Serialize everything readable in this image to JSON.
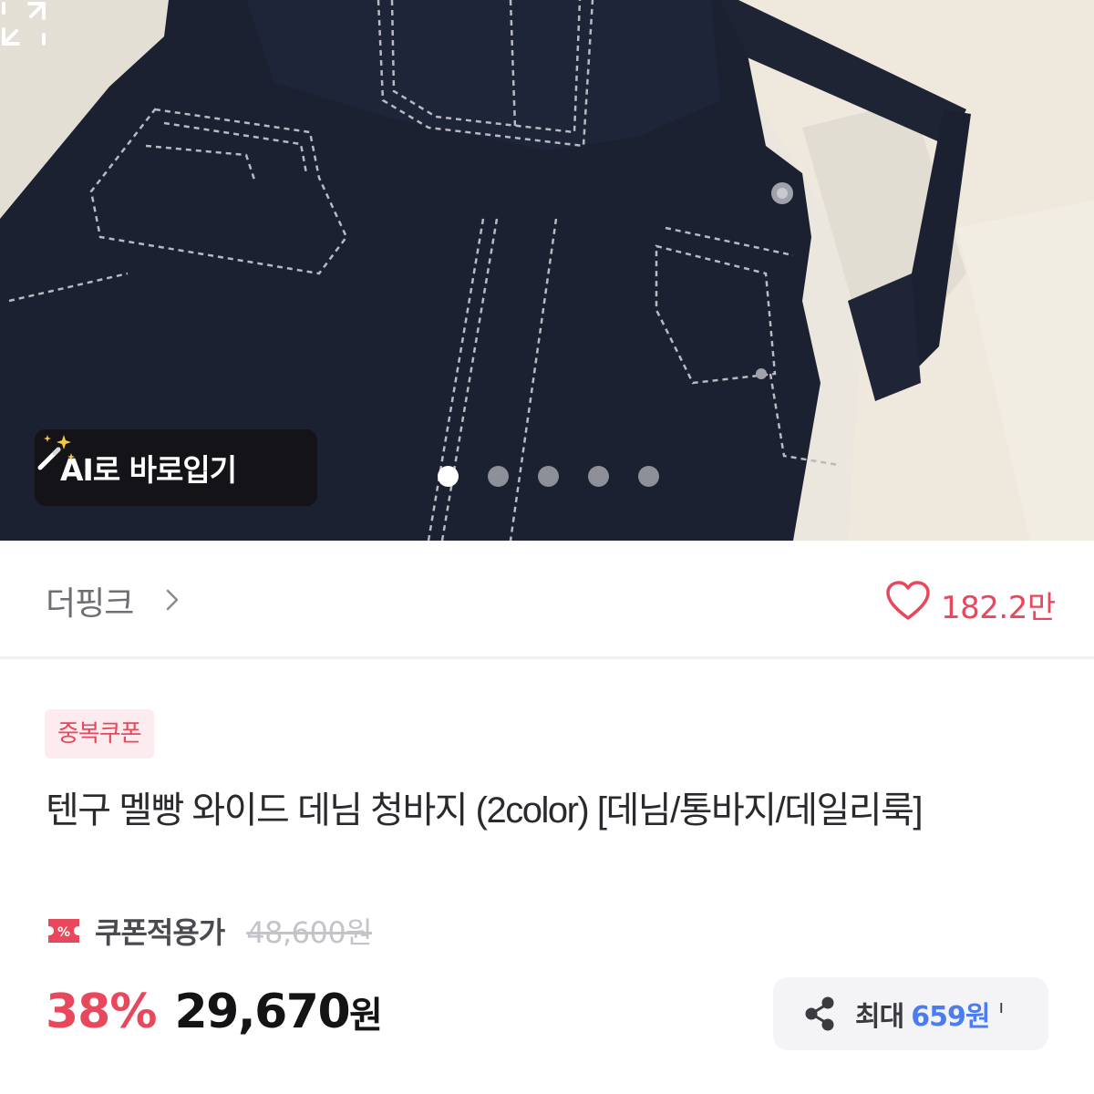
{
  "hero": {
    "ai_button_label": "AI로 바로입기",
    "carousel": {
      "total": 5,
      "active_index": 0
    },
    "icons": {
      "ai": "magic-wand-icon",
      "expand": "expand-icon"
    }
  },
  "store": {
    "name": "더핑크",
    "like_count": "182.2만",
    "icons": {
      "chevron": "chevron-right-icon",
      "like": "heart-icon"
    }
  },
  "product": {
    "badge": "중복쿠폰",
    "title": "텐구 멜빵 와이드 데님 청바지 (2color) [데님/통바지/데일리룩]",
    "coupon_label": "쿠폰적용가",
    "original_price": "48,600원",
    "discount": "38%",
    "price": "29,670",
    "price_unit": "원"
  },
  "share": {
    "label": "최대",
    "amount": "659원",
    "icon": "share-icon"
  },
  "colors": {
    "accent": "#e8475c",
    "share_amount": "#4a7df0",
    "denim": "#1b2131"
  }
}
